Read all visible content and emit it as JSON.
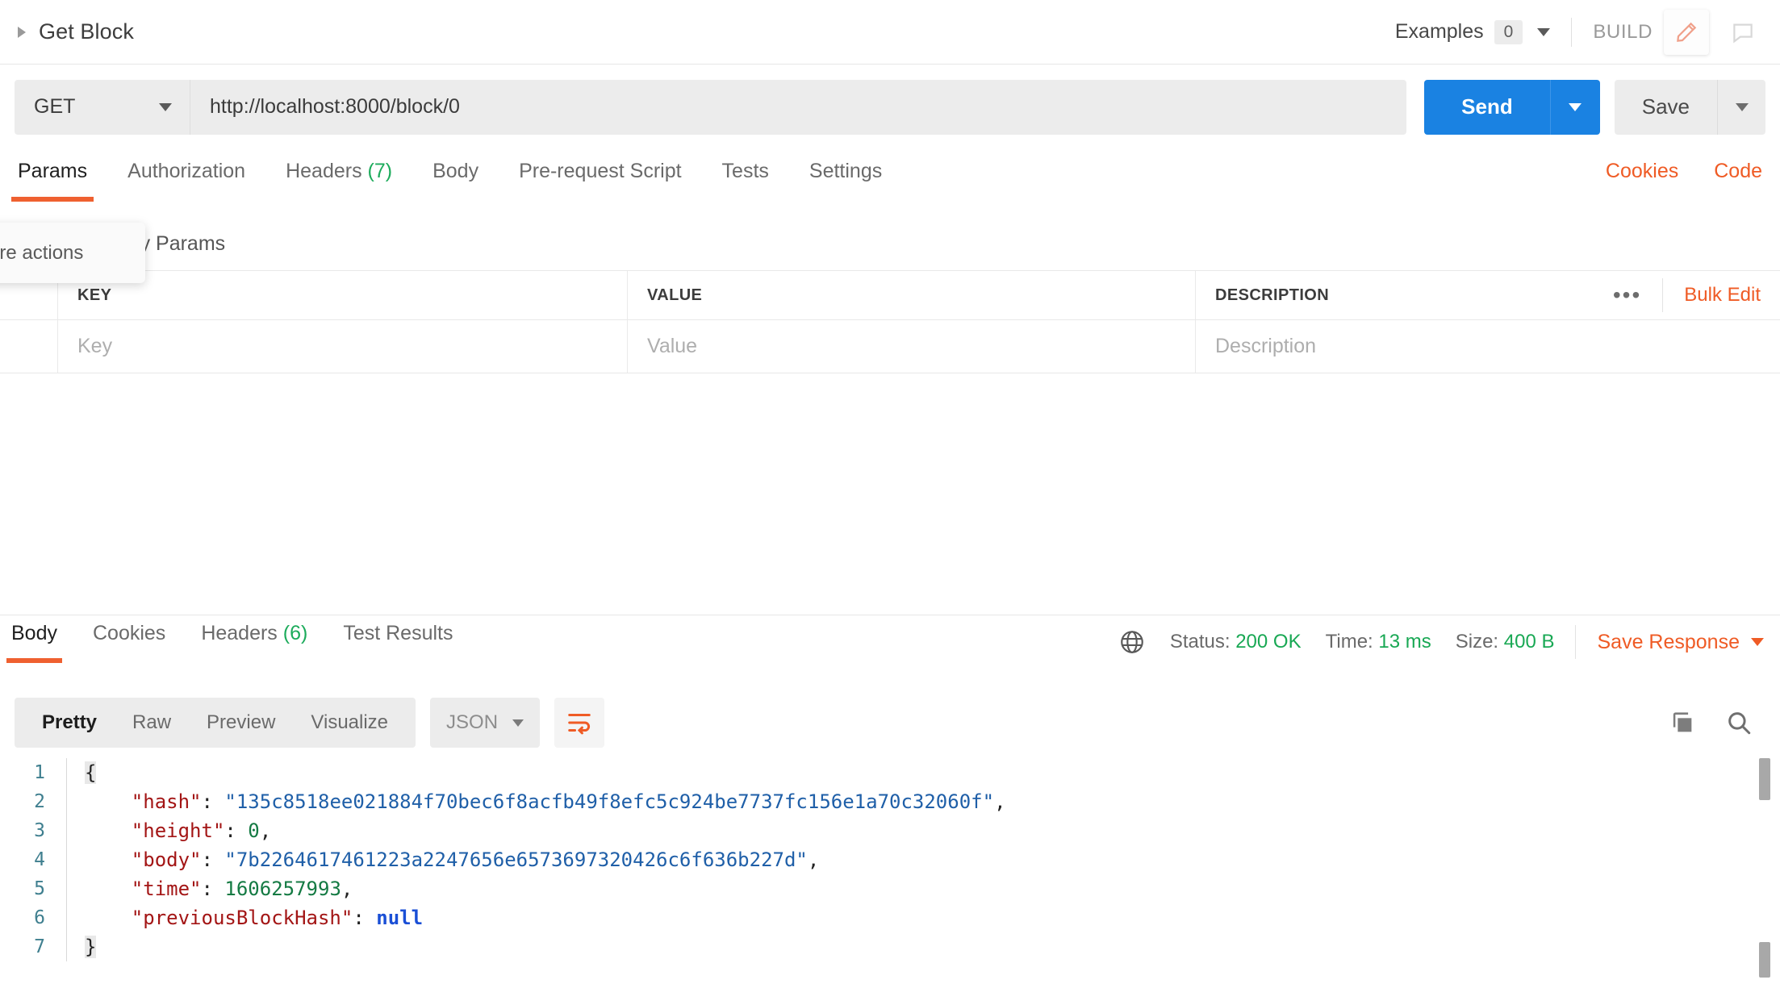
{
  "topbar": {
    "request_name": "Get Block",
    "collapse_icon": "caret-right-icon",
    "examples_label": "Examples",
    "examples_count": "0",
    "build_label": "BUILD",
    "edit_icon": "pencil-icon",
    "comment_icon": "comment-icon"
  },
  "request": {
    "method": "GET",
    "url": "http://localhost:8000/block/0",
    "send_label": "Send",
    "save_label": "Save"
  },
  "request_tabs": [
    {
      "label": "Params",
      "active": true,
      "count": ""
    },
    {
      "label": "Authorization",
      "active": false,
      "count": ""
    },
    {
      "label": "Headers",
      "active": false,
      "count": "(7)"
    },
    {
      "label": "Body",
      "active": false,
      "count": ""
    },
    {
      "label": "Pre-request Script",
      "active": false,
      "count": ""
    },
    {
      "label": "Tests",
      "active": false,
      "count": ""
    },
    {
      "label": "Settings",
      "active": false,
      "count": ""
    }
  ],
  "request_tabs_right": {
    "cookies": "Cookies",
    "code": "Code"
  },
  "tooltip": {
    "text": "w more actions"
  },
  "params": {
    "section_label": "Query Params",
    "headers": {
      "key": "KEY",
      "value": "VALUE",
      "description": "DESCRIPTION"
    },
    "placeholders": {
      "key": "Key",
      "value": "Value",
      "description": "Description"
    },
    "more_icon": "ellipsis-icon",
    "bulk_edit": "Bulk Edit"
  },
  "response_tabs": [
    {
      "label": "Body",
      "active": true,
      "count": ""
    },
    {
      "label": "Cookies",
      "active": false,
      "count": ""
    },
    {
      "label": "Headers",
      "active": false,
      "count": "(6)"
    },
    {
      "label": "Test Results",
      "active": false,
      "count": ""
    }
  ],
  "response_meta": {
    "globe_icon": "globe-icon",
    "status_label": "Status:",
    "status_value": "200 OK",
    "time_label": "Time:",
    "time_value": "13 ms",
    "size_label": "Size:",
    "size_value": "400 B",
    "save_response": "Save Response",
    "status_color": "#19a854"
  },
  "view_toolbar": {
    "modes": [
      {
        "label": "Pretty",
        "active": true
      },
      {
        "label": "Raw",
        "active": false
      },
      {
        "label": "Preview",
        "active": false
      },
      {
        "label": "Visualize",
        "active": false
      }
    ],
    "format": "JSON",
    "wrap_icon": "word-wrap-icon",
    "copy_icon": "copy-icon",
    "search_icon": "search-icon"
  },
  "response_body": {
    "line_numbers": [
      "1",
      "2",
      "3",
      "4",
      "5",
      "6",
      "7"
    ],
    "lines": [
      {
        "n": "1",
        "tokens": [
          {
            "t": "pun",
            "v": "{"
          }
        ]
      },
      {
        "n": "2",
        "tokens": [
          {
            "t": "key",
            "v": "    \"hash\""
          },
          {
            "t": "pun",
            "v": ": "
          },
          {
            "t": "str",
            "v": "\"135c8518ee021884f70bec6f8acfb49f8efc5c924be7737fc156e1a70c32060f\""
          },
          {
            "t": "pun",
            "v": ","
          }
        ]
      },
      {
        "n": "3",
        "tokens": [
          {
            "t": "key",
            "v": "    \"height\""
          },
          {
            "t": "pun",
            "v": ": "
          },
          {
            "t": "num",
            "v": "0"
          },
          {
            "t": "pun",
            "v": ","
          }
        ]
      },
      {
        "n": "4",
        "tokens": [
          {
            "t": "key",
            "v": "    \"body\""
          },
          {
            "t": "pun",
            "v": ": "
          },
          {
            "t": "str",
            "v": "\"7b2264617461223a2247656e6573697320426c6f636b227d\""
          },
          {
            "t": "pun",
            "v": ","
          }
        ]
      },
      {
        "n": "5",
        "tokens": [
          {
            "t": "key",
            "v": "    \"time\""
          },
          {
            "t": "pun",
            "v": ": "
          },
          {
            "t": "num",
            "v": "1606257993"
          },
          {
            "t": "pun",
            "v": ","
          }
        ]
      },
      {
        "n": "6",
        "tokens": [
          {
            "t": "key",
            "v": "    \"previousBlockHash\""
          },
          {
            "t": "pun",
            "v": ": "
          },
          {
            "t": "null",
            "v": "null"
          }
        ]
      },
      {
        "n": "7",
        "tokens": [
          {
            "t": "pun",
            "v": "}"
          }
        ]
      }
    ]
  },
  "colors": {
    "accent_orange": "#ef5b25",
    "send_blue": "#1a82e2",
    "success_green": "#19a854"
  }
}
